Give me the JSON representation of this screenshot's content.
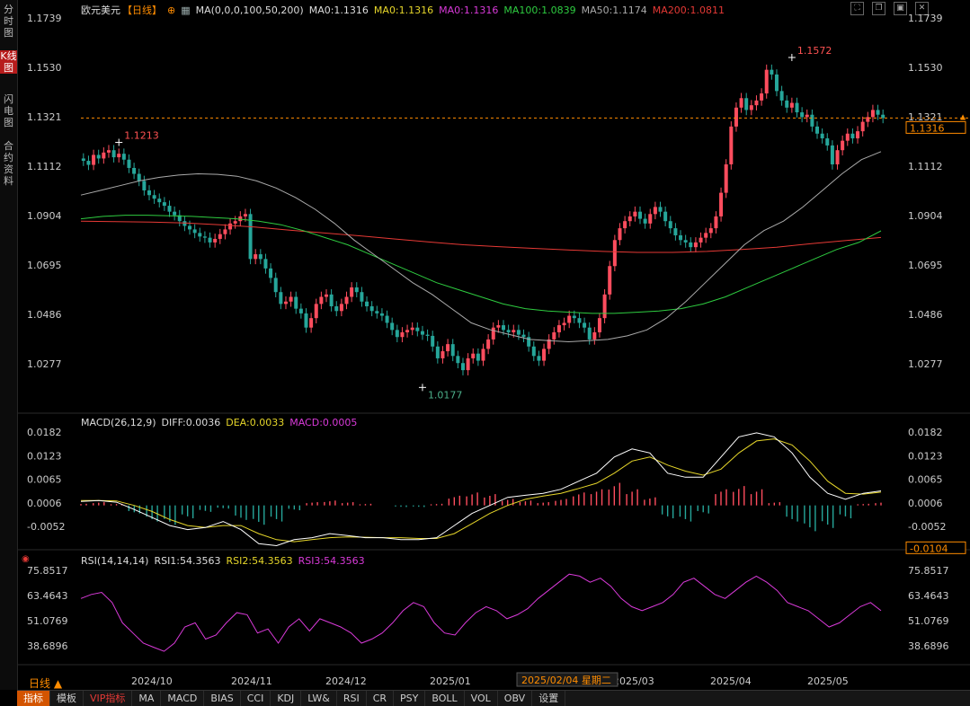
{
  "symbol": "欧元美元",
  "period": "【日线】",
  "sidebar": [
    {
      "label": "分时图",
      "active": false
    },
    {
      "label": "K线图",
      "active": true
    },
    {
      "label": "闪电图",
      "active": false
    },
    {
      "label": "合约资料",
      "active": false
    }
  ],
  "main_legend": {
    "ma_params": "MA(0,0,0,100,50,200)",
    "items": [
      {
        "text": "MA0:1.1316",
        "color": "#dddddd"
      },
      {
        "text": "MA0:1.1316",
        "color": "#e6d62a"
      },
      {
        "text": "MA0:1.1316",
        "color": "#d93ad9"
      },
      {
        "text": "MA100:1.0839",
        "color": "#2ecc40"
      },
      {
        "text": "MA50:1.1174",
        "color": "#aaaaaa"
      },
      {
        "text": "MA200:1.0811",
        "color": "#e53935"
      }
    ]
  },
  "macd_legend": {
    "title": "MACD(26,12,9)",
    "items": [
      {
        "text": "DIFF:0.0036",
        "color": "#dddddd"
      },
      {
        "text": "DEA:0.0033",
        "color": "#e6d62a"
      },
      {
        "text": "MACD:0.0005",
        "color": "#d93ad9"
      }
    ]
  },
  "rsi_legend": {
    "title": "RSI(14,14,14)",
    "items": [
      {
        "text": "RSI1:54.3563",
        "color": "#dddddd"
      },
      {
        "text": "RSI2:54.3563",
        "color": "#e6d62a"
      },
      {
        "text": "RSI3:54.3563",
        "color": "#d93ad9"
      }
    ]
  },
  "bottom_period": "日线",
  "bottom_tabs": [
    "指标",
    "模板",
    "VIP指标",
    "MA",
    "MACD",
    "BIAS",
    "CCI",
    "KDJ",
    "LW&",
    "RSI",
    "CR",
    "PSY",
    "BOLL",
    "VOL",
    "OBV",
    "设置"
  ],
  "chart_data": {
    "type": "candlestick",
    "price_ticks": [
      "1.1739",
      "1.1530",
      "1.1321",
      "1.1112",
      "1.0904",
      "1.0695",
      "1.0486",
      "1.0277"
    ],
    "macd_ticks": [
      "0.0182",
      "0.0123",
      "0.0065",
      "0.0006",
      "-0.0052"
    ],
    "rsi_ticks": [
      "75.8517",
      "63.4643",
      "51.0769",
      "38.6896"
    ],
    "x_labels": [
      "2024/10",
      "2024/11",
      "2024/12",
      "2025/01",
      "2025/03",
      "2025/04",
      "2025/05"
    ],
    "crosshair_date": "2025/02/04 星期二",
    "current_price": "1.1316",
    "macd_current": "-0.0104",
    "annotations": [
      {
        "label": "1.1213",
        "price": 1.1213,
        "color": "#ff5252"
      },
      {
        "label": "1.0177",
        "price": 1.0177,
        "color": "#4caf8a"
      },
      {
        "label": "1.1572",
        "price": 1.1572,
        "color": "#ff5252"
      }
    ],
    "closes": [
      1.1135,
      1.1118,
      1.116,
      1.1145,
      1.117,
      1.118,
      1.115,
      1.1165,
      1.114,
      1.1105,
      1.108,
      1.105,
      1.101,
      1.099,
      1.0975,
      1.096,
      1.0945,
      1.092,
      1.0905,
      1.088,
      1.086,
      1.0845,
      1.083,
      1.0815,
      1.081,
      1.079,
      1.0805,
      1.0825,
      1.0845,
      1.087,
      1.088,
      1.09,
      1.091,
      1.072,
      1.074,
      1.072,
      1.068,
      1.064,
      1.058,
      1.053,
      1.054,
      1.056,
      1.051,
      1.049,
      1.043,
      1.047,
      1.053,
      1.056,
      1.057,
      1.052,
      1.05,
      1.053,
      1.056,
      1.06,
      1.058,
      1.054,
      1.052,
      1.05,
      1.049,
      1.048,
      1.045,
      1.042,
      1.039,
      1.041,
      1.042,
      1.043,
      1.0415,
      1.04,
      1.0395,
      1.035,
      1.03,
      1.033,
      1.036,
      1.031,
      1.028,
      1.025,
      1.03,
      1.032,
      1.029,
      1.034,
      1.038,
      1.043,
      1.044,
      1.042,
      1.041,
      1.042,
      1.04,
      1.039,
      1.035,
      1.031,
      1.029,
      1.034,
      1.038,
      1.041,
      1.044,
      1.045,
      1.048,
      1.047,
      1.045,
      1.043,
      1.038,
      1.041,
      1.047,
      1.057,
      1.069,
      1.08,
      1.085,
      1.088,
      1.09,
      1.092,
      1.089,
      1.087,
      1.091,
      1.094,
      1.092,
      1.088,
      1.085,
      1.082,
      1.08,
      1.079,
      1.077,
      1.079,
      1.081,
      1.083,
      1.085,
      1.09,
      1.1,
      1.112,
      1.128,
      1.136,
      1.14,
      1.135,
      1.137,
      1.139,
      1.142,
      1.152,
      1.15,
      1.143,
      1.139,
      1.136,
      1.138,
      1.134,
      1.132,
      1.133,
      1.128,
      1.125,
      1.123,
      1.12,
      1.112,
      1.118,
      1.122,
      1.125,
      1.123,
      1.126,
      1.13,
      1.132,
      1.135,
      1.133,
      1.1316
    ],
    "ma50": [
      1.099,
      1.101,
      1.103,
      1.105,
      1.1065,
      1.1075,
      1.108,
      1.1078,
      1.107,
      1.105,
      1.102,
      1.098,
      1.093,
      1.087,
      1.08,
      1.074,
      1.068,
      1.062,
      1.057,
      1.051,
      1.045,
      1.042,
      1.04,
      1.038,
      1.0375,
      1.037,
      1.0375,
      1.038,
      1.0395,
      1.042,
      1.047,
      1.054,
      1.062,
      1.07,
      1.078,
      1.084,
      1.088,
      1.094,
      1.101,
      1.108,
      1.114,
      1.1174
    ],
    "ma100": [
      1.089,
      1.09,
      1.0905,
      1.0905,
      1.0903,
      1.09,
      1.0895,
      1.089,
      1.088,
      1.0865,
      1.084,
      1.081,
      1.078,
      1.074,
      1.07,
      1.066,
      1.062,
      1.059,
      1.056,
      1.053,
      1.051,
      1.05,
      1.0495,
      1.049,
      1.049,
      1.0495,
      1.05,
      1.051,
      1.053,
      1.056,
      1.06,
      1.064,
      1.068,
      1.072,
      1.076,
      1.079,
      1.0839
    ],
    "ma200": [
      1.088,
      1.0878,
      1.0876,
      1.0872,
      1.0865,
      1.0855,
      1.0842,
      1.083,
      1.0818,
      1.0805,
      1.0792,
      1.078,
      1.0772,
      1.0765,
      1.0758,
      1.0752,
      1.0748,
      1.0748,
      1.0752,
      1.076,
      1.077,
      1.0785,
      1.0798,
      1.0811
    ],
    "macd_diff": [
      0.001,
      0.0012,
      0.0008,
      -0.001,
      -0.003,
      -0.005,
      -0.006,
      -0.0055,
      -0.004,
      -0.006,
      -0.0095,
      -0.01,
      -0.0085,
      -0.008,
      -0.007,
      -0.0075,
      -0.008,
      -0.008,
      -0.0085,
      -0.0085,
      -0.008,
      -0.005,
      -0.002,
      0.0,
      0.002,
      0.0025,
      0.003,
      0.004,
      0.006,
      0.008,
      0.012,
      0.014,
      0.013,
      0.008,
      0.007,
      0.007,
      0.012,
      0.017,
      0.018,
      0.017,
      0.013,
      0.007,
      0.003,
      0.0015,
      0.003,
      0.0036
    ],
    "macd_dea": [
      0.0012,
      0.0012,
      0.0011,
      0.0,
      -0.0015,
      -0.0035,
      -0.005,
      -0.0055,
      -0.005,
      -0.005,
      -0.007,
      -0.0085,
      -0.009,
      -0.0085,
      -0.008,
      -0.0078,
      -0.0079,
      -0.008,
      -0.008,
      -0.0082,
      -0.0082,
      -0.007,
      -0.0045,
      -0.002,
      0.0,
      0.0015,
      0.0023,
      0.003,
      0.0042,
      0.0055,
      0.008,
      0.011,
      0.012,
      0.01,
      0.0085,
      0.0075,
      0.009,
      0.013,
      0.016,
      0.0165,
      0.015,
      0.011,
      0.006,
      0.003,
      0.0028,
      0.0033
    ],
    "rsi": [
      62,
      64,
      65,
      60,
      50,
      45,
      40,
      38,
      36,
      40,
      48,
      50,
      42,
      44,
      50,
      55,
      54,
      45,
      47,
      40,
      48,
      52,
      46,
      52,
      50,
      48,
      45,
      40,
      42,
      45,
      50,
      56,
      60,
      58,
      50,
      45,
      44,
      50,
      55,
      58,
      56,
      52,
      54,
      57,
      62,
      66,
      70,
      74,
      73,
      70,
      72,
      68,
      62,
      58,
      56,
      58,
      60,
      64,
      70,
      72,
      68,
      64,
      62,
      66,
      70,
      73,
      70,
      66,
      60,
      58,
      56,
      52,
      48,
      50,
      54,
      58,
      60,
      56
    ],
    "macd_hist": [
      0.0001,
      0.0002,
      0.0001,
      -0.0005,
      -0.001,
      -0.0012,
      -0.0008,
      -0.0004,
      -0.0002,
      -0.0009,
      -0.0012,
      -0.001,
      -0.0003,
      0.0002,
      0.0003,
      0.0002,
      0.0001,
      0.0,
      -0.0001,
      -0.0001,
      0.0001,
      0.0006,
      0.0008,
      0.0007,
      0.0004,
      0.0003,
      0.0002,
      0.0004,
      0.0008,
      0.001,
      0.0014,
      0.001,
      0.0005,
      -0.0008,
      -0.001,
      -0.0005,
      0.001,
      0.0012,
      0.001,
      0.0002,
      -0.001,
      -0.0016,
      -0.0014,
      -0.0008,
      0.0001,
      0.0002
    ]
  }
}
